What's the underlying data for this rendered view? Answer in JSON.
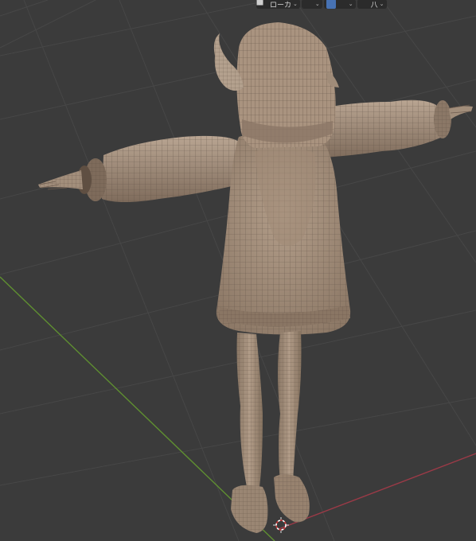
{
  "header": {
    "pivot_icon": "pivot-point-icon",
    "orientation_label": "ローカ",
    "orientation_chevron": "⌄",
    "snap_icon": "snap-icon",
    "snap_chevron": "⌄",
    "proportional_icon": "proportional-edit-icon",
    "grid_icon": "snap-increment-icon",
    "grid_chevron": "⌄",
    "overlay_icon": "overlay-icon",
    "misc_label": "八",
    "misc_chevron": "⌄"
  },
  "colors": {
    "grid_bg": "#3b3b3b",
    "grid_line": "#464646",
    "x_axis": "#9b3a47",
    "y_axis": "#5f8f31",
    "mesh": "#a89380",
    "mesh_dark": "#6d5c4f",
    "wire": "#5b4c41",
    "accent": "#4772b3"
  }
}
